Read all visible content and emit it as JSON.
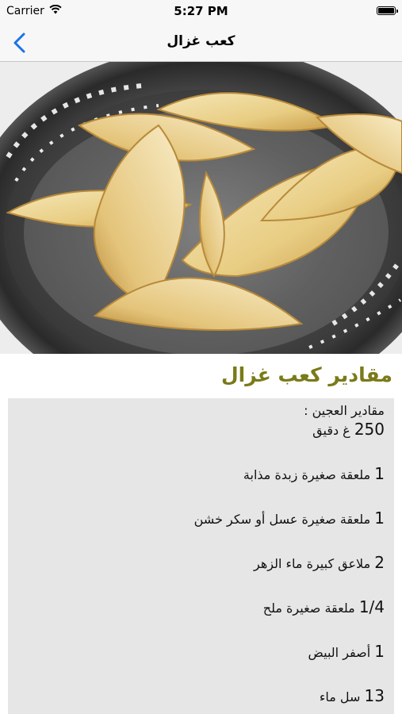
{
  "status": {
    "carrier": "Carrier",
    "time": "5:27 PM"
  },
  "nav": {
    "title": "كعب غزال"
  },
  "hero": {
    "image_description": "كعب غزال"
  },
  "section": {
    "title": "مقادير كعب غزال",
    "title_color": "#7a7a1a"
  },
  "content": {
    "header": "مقادير العجين :",
    "items": [
      {
        "qty": "250",
        "text": "غ دقيق"
      },
      {
        "qty": "1",
        "text": "ملعقة صغيرة زبدة مذابة"
      },
      {
        "qty": "1",
        "text": "ملعقة صغيرة عسل أو سكر خشن"
      },
      {
        "qty": "2",
        "text": "ملاعق كبيرة ماء الزهر"
      },
      {
        "qty": "1/4",
        "text": "ملعقة صغيرة ملح"
      },
      {
        "qty": "1",
        "text": "أصفر البيض"
      },
      {
        "qty": "13",
        "text": "سل ماء"
      }
    ]
  },
  "colors": {
    "accent": "#1a73e8",
    "box_bg": "#e6e6e6",
    "bar_bg": "#f7f7f7"
  }
}
